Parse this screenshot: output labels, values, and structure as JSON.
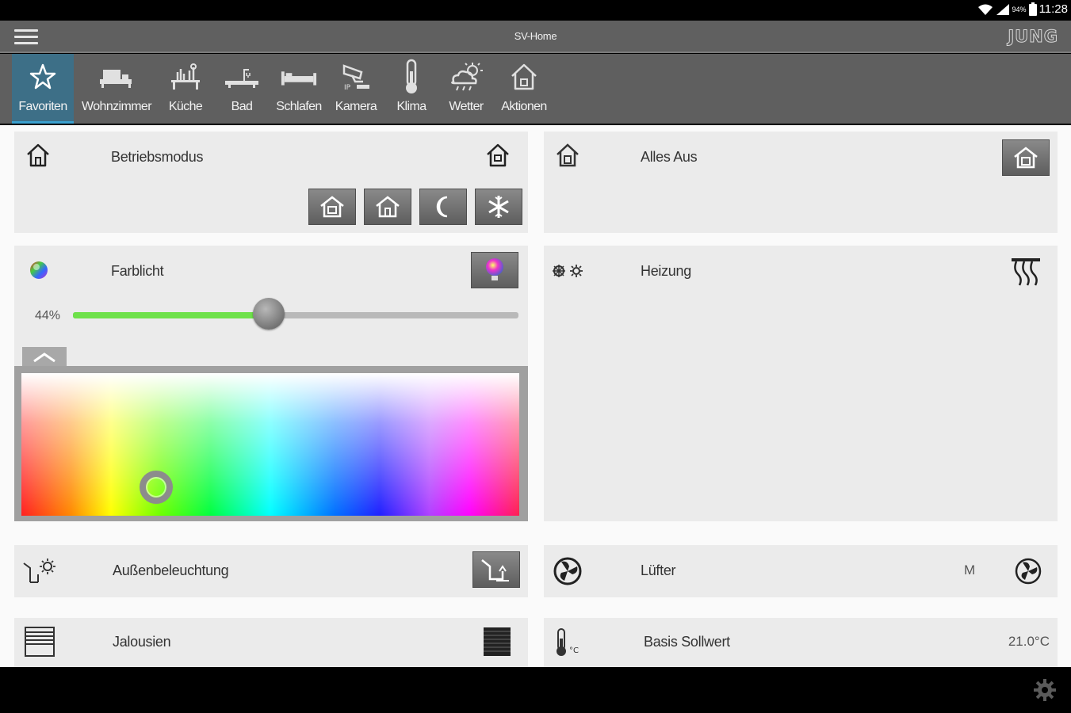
{
  "status_bar": {
    "time": "11:28",
    "battery_percent": "94%",
    "wifi_icon": "wifi-icon",
    "signal_icon": "cell-signal-icon",
    "battery_icon": "battery-icon"
  },
  "app_bar": {
    "title": "SV-Home",
    "brand": "JUNG",
    "menu_icon": "hamburger-menu-icon"
  },
  "tabs": [
    {
      "label": "Favoriten",
      "icon": "star-icon",
      "active": true
    },
    {
      "label": "Wohnzimmer",
      "icon": "sofa-icon"
    },
    {
      "label": "Küche",
      "icon": "kitchen-icon"
    },
    {
      "label": "Bad",
      "icon": "bathtub-icon"
    },
    {
      "label": "Schlafen",
      "icon": "bed-icon"
    },
    {
      "label": "Kamera",
      "icon": "ip-camera-icon"
    },
    {
      "label": "Klima",
      "icon": "thermometer-icon"
    },
    {
      "label": "Wetter",
      "icon": "weather-icon"
    },
    {
      "label": "Aktionen",
      "icon": "house-icon"
    }
  ],
  "cards": {
    "betriebsmodus": {
      "label": "Betriebsmodus",
      "icon": "house-icon",
      "status_icon": "house-icon",
      "mode_buttons": [
        "house-comfort-icon",
        "house-standby-icon",
        "moon-night-icon",
        "snowflake-frost-icon"
      ]
    },
    "alles_aus": {
      "label": "Alles Aus",
      "icon": "house-off-icon",
      "button_icon": "house-off-icon"
    },
    "farblicht": {
      "label": "Farblicht",
      "icon": "color-sphere-icon",
      "button_icon": "color-bulb-icon",
      "dim_value_text": "44%",
      "dim_fraction": 0.44,
      "picker_selected_hue_fraction": 0.27,
      "picker_selected_saturation_fraction": 0.8
    },
    "heizung": {
      "label": "Heizung",
      "icon": "heat-cool-icon",
      "button_icon": "radiator-icon"
    },
    "aussenbeleuchtung": {
      "label": "Außenbeleuchtung",
      "icon": "outdoor-light-icon",
      "button_icon": "outdoor-light-icon"
    },
    "luefter": {
      "label": "Lüfter",
      "icon": "fan-icon",
      "value": "M",
      "button_icon": "fan-icon"
    },
    "jalousien": {
      "label": "Jalousien",
      "icon": "blinds-icon",
      "button_icon": "blinds-closed-icon"
    },
    "basis_sollwert": {
      "label": "Basis Sollwert",
      "icon": "thermometer-celsius-icon",
      "value": "21.0°C"
    }
  },
  "bottom_bar": {
    "settings_icon": "gear-icon"
  },
  "colors": {
    "tab_active_bg": "#3d6f87",
    "tab_active_indicator": "#3aa0d0",
    "slider_fill": "#6ee14a",
    "appbar_bg": "#606060"
  }
}
